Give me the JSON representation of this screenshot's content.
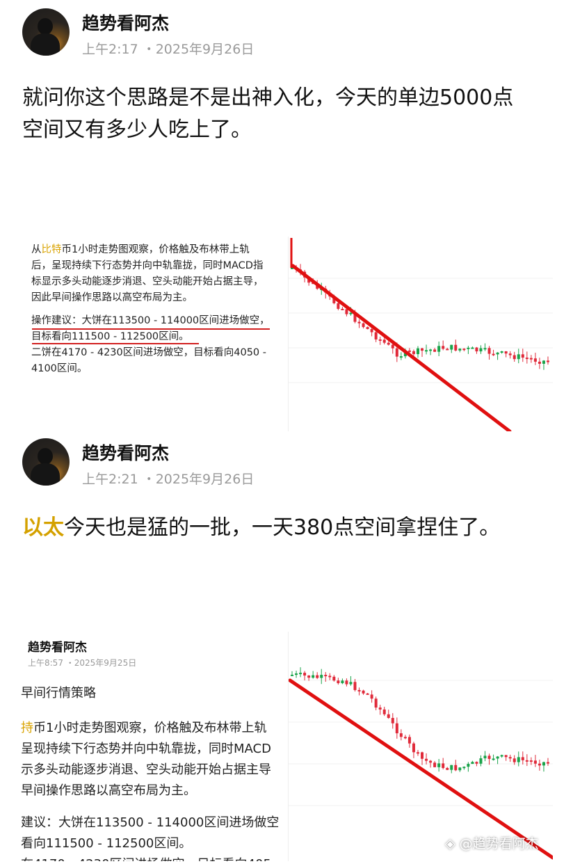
{
  "post1": {
    "user_name": "趋势看阿杰",
    "time": "上午2:17 ・2025年9月26日",
    "text_line1": "就问你这个思路是不是出神入化，今天的单边5000点",
    "text_line2": "空间又有多少人吃上了。",
    "card": {
      "para1_line1_pre": "从",
      "para1_line1_hl": "比特",
      "para1_line1_post": "币1小时走势图观察，价格触及布林带上轨",
      "para1_line2": "后，呈现持续下行态势并向中轨靠拢，同时MACD指",
      "para1_line3": "标显示多头动能逐步消退、空头动能开始占据主导，",
      "para1_line4": "因此早间操作思路以高空布局为主。",
      "para2_line1": "操作建议：大饼在113500 - 114000区间进场做空，",
      "para2_line2": "目标看向111500 - 112500区间。",
      "para2_line3": "二饼在4170 - 4230区间进场做空，目标看向4050 -",
      "para2_line4": "4100区间。"
    }
  },
  "post2": {
    "user_name": "趋势看阿杰",
    "time": "上午2:21 ・2025年9月26日",
    "text_highlight": "以太",
    "text_rest": "今天也是猛的一批，一天380点空间拿捏住了。",
    "screenshot": {
      "user_name": "趋势看阿杰",
      "time": "上午8:57 ・2025年9月25日",
      "heading": "早间行情策略",
      "line1_hl": "持",
      "line1_rest": "币1小时走势图观察，价格触及布林带上轨",
      "line2": "呈现持续下行态势并向中轨靠拢，同时MACD",
      "line3": "示多头动能逐步消退、空头动能开始占据主导",
      "line4": "早间操作思路以高空布局为主。",
      "line5": "建议：大饼在113500 - 114000区间进场做空",
      "line6": "看向111500 - 112500区间。",
      "line7": "在4170 - 4230区间进场做空，目标看向405"
    }
  },
  "watermark": "@趋势看阿杰",
  "colors": {
    "up": "#1aa34a",
    "down": "#e02a3a",
    "trend": "#e01010",
    "highlight": "#d4a100"
  },
  "icons": {
    "avatar": "avatar-photo",
    "watermark": "diamond-logo-icon"
  }
}
